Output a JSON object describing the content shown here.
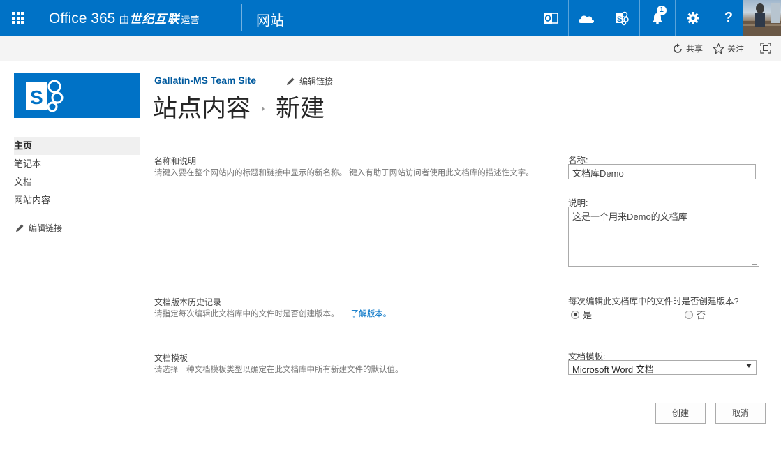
{
  "suite": {
    "brand": "Office 365",
    "brand_by": "由",
    "brand_vendor": "世纪互联",
    "brand_ops": "运营",
    "app_name": "网站",
    "notification_count": "1",
    "bar_color": "#0072c6"
  },
  "ribbon": {
    "share": "共享",
    "follow": "关注"
  },
  "nav": {
    "items": [
      "主页",
      "笔记本",
      "文档",
      "网站内容"
    ],
    "selected": "主页",
    "edit_links": "编辑链接"
  },
  "header": {
    "site_title": "Gallatin-MS Team Site",
    "edit_links": "编辑链接",
    "breadcrumb_root": "站点内容",
    "breadcrumb_current": "新建"
  },
  "form": {
    "name_section": {
      "title": "名称和说明",
      "description": "请键入要在整个网站内的标题和链接中显示的新名称。 键入有助于网站访问者使用此文档库的描述性文字。",
      "name_label": "名称:",
      "name_value": "文档库Demo",
      "desc_label": "说明:",
      "desc_value": "这是一个用来Demo的文档库"
    },
    "version_section": {
      "title": "文档版本历史记录",
      "description": "请指定每次编辑此文档库中的文件时是否创建版本。",
      "learn_more": "了解版本。",
      "question": "每次编辑此文档库中的文件时是否创建版本?",
      "option_yes": "是",
      "option_no": "否",
      "selected": "是"
    },
    "template_section": {
      "title": "文档模板",
      "description": "请选择一种文档模板类型以确定在此文档库中所有新建文件的默认值。",
      "template_label": "文档模板:",
      "template_value": "Microsoft Word 文档"
    },
    "buttons": {
      "create": "创建",
      "cancel": "取消"
    }
  }
}
